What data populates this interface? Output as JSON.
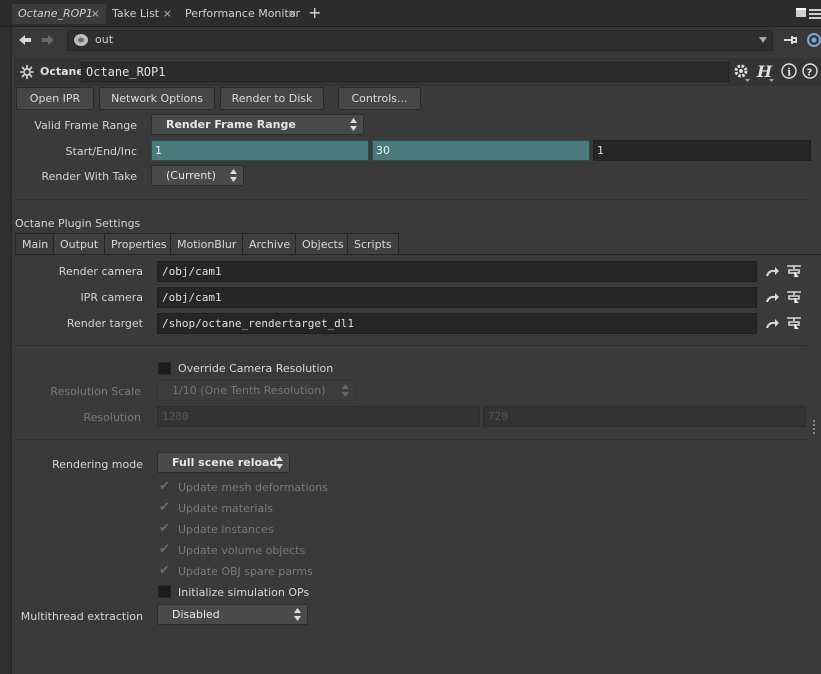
{
  "tabs": [
    {
      "label": "Octane_ROP1",
      "active": true
    },
    {
      "label": "Take List",
      "active": false
    },
    {
      "label": "Performance Monitor",
      "active": false
    }
  ],
  "path": {
    "value": "out"
  },
  "node": {
    "type": "Octane",
    "name": "Octane_ROP1"
  },
  "toolbar": {
    "open_ipr": "Open IPR",
    "network_options": "Network Options",
    "render_to_disk": "Render to Disk",
    "controls": "Controls..."
  },
  "frame": {
    "valid_range_label": "Valid Frame Range",
    "valid_range_value": "Render Frame Range",
    "sei_label": "Start/End/Inc",
    "start": "1",
    "end": "30",
    "inc": "1",
    "take_label": "Render With Take",
    "take_value": "(Current)"
  },
  "section_title": "Octane Plugin Settings",
  "param_tabs": [
    "Main",
    "Output",
    "Properties",
    "MotionBlur",
    "Archive",
    "Objects",
    "Scripts"
  ],
  "main": {
    "render_camera_label": "Render camera",
    "render_camera": "/obj/cam1",
    "ipr_camera_label": "IPR camera",
    "ipr_camera": "/obj/cam1",
    "render_target_label": "Render target",
    "render_target": "/shop/octane_rendertarget_dl1",
    "override_label": "Override Camera Resolution",
    "res_scale_label": "Resolution Scale",
    "res_scale_value": "1/10 (One Tenth Resolution)",
    "resolution_label": "Resolution",
    "res_x": "1280",
    "res_y": "720",
    "rendering_mode_label": "Rendering mode",
    "rendering_mode_value": "Full scene reload",
    "updates": [
      "Update mesh deformations",
      "Update materials",
      "Update instances",
      "Update volume objects",
      "Update OBJ spare parms"
    ],
    "init_sim_label": "Initialize simulation OPs",
    "multithread_label": "Multithread extraction",
    "multithread_value": "Disabled"
  },
  "colors": {
    "accent_teal": "#4b7a7c",
    "background": "#3a3a3a"
  }
}
